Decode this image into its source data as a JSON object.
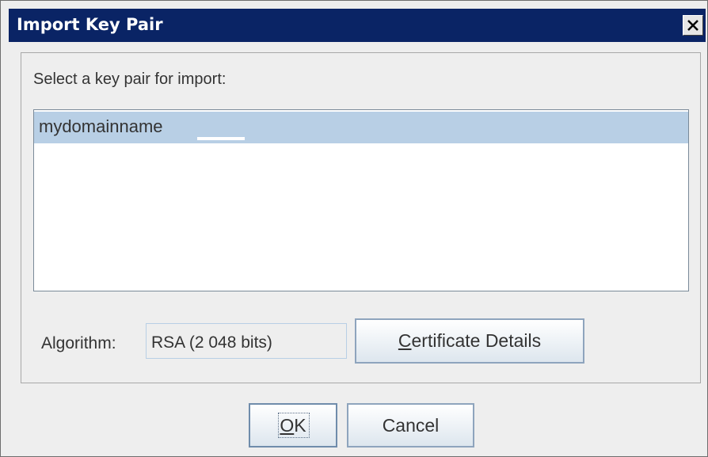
{
  "dialog": {
    "title": "Import Key Pair",
    "close_icon": "close-icon"
  },
  "prompt_label": "Select a key pair for import:",
  "key_list": {
    "items": [
      {
        "label": "mydomainname",
        "selected": true
      }
    ]
  },
  "algorithm": {
    "label": "Algorithm:",
    "value": "RSA (2 048 bits)"
  },
  "buttons": {
    "certificate_details": {
      "mnemonic": "C",
      "rest": "ertificate Details"
    },
    "ok": {
      "mnemonic": "O",
      "rest": "K"
    },
    "cancel": "Cancel"
  },
  "colors": {
    "titlebar": "#0a2465",
    "selection": "#b8cfe5",
    "dialog_bg": "#eeeeee"
  }
}
